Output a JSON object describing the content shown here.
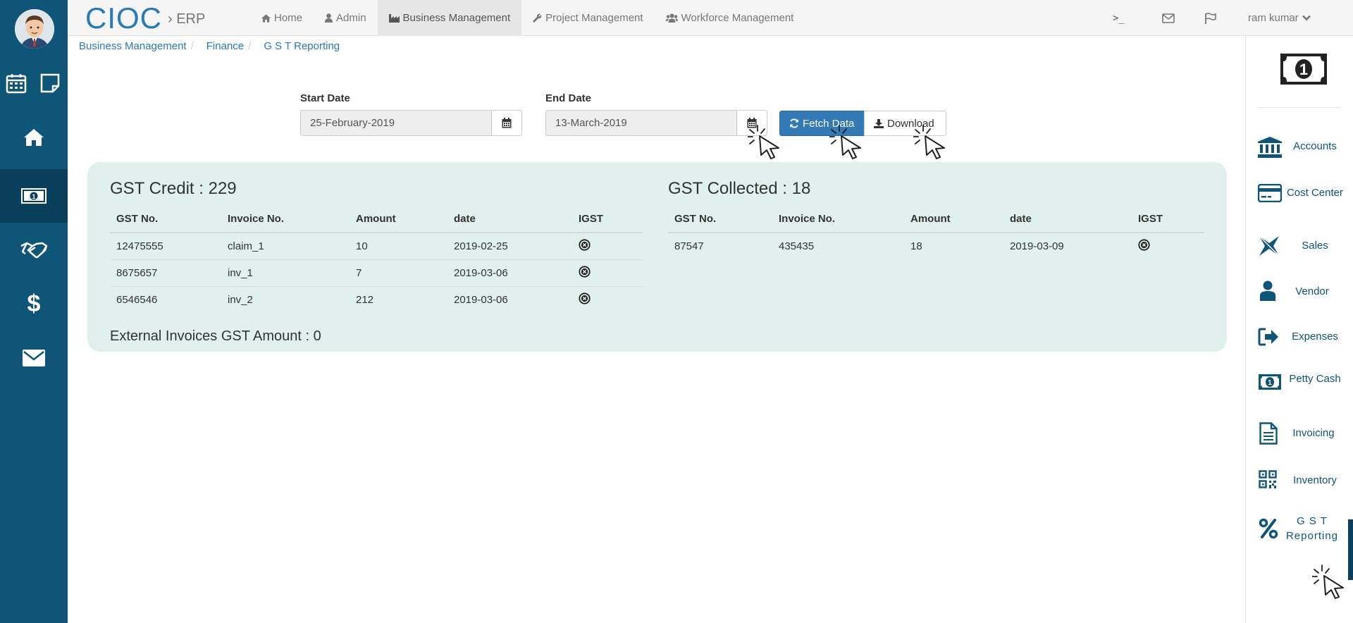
{
  "brand": {
    "name": "CIOC",
    "sub": "› ERP"
  },
  "nav": [
    {
      "label": "Home",
      "icon": "home-icon"
    },
    {
      "label": "Admin",
      "icon": "user-icon"
    },
    {
      "label": "Business Management",
      "icon": "industry-icon",
      "active": true
    },
    {
      "label": "Project Management",
      "icon": "wrench-icon"
    },
    {
      "label": "Workforce Management",
      "icon": "users-icon"
    }
  ],
  "top_right": {
    "terminal": ">_",
    "user": "ram kumar"
  },
  "breadcrumb": [
    "Business Management",
    "Finance",
    "G S T Reporting"
  ],
  "form": {
    "start_label": "Start Date",
    "start_value": "25-February-2019",
    "end_label": "End Date",
    "end_value": "13-March-2019",
    "fetch_label": "Fetch Data",
    "download_label": "Download"
  },
  "credit": {
    "title": "GST Credit : 229",
    "headers": [
      "GST No.",
      "Invoice No.",
      "Amount",
      "date",
      "IGST"
    ],
    "rows": [
      [
        "12475555",
        "claim_1",
        "10",
        "2019-02-25"
      ],
      [
        "8675657",
        "inv_1",
        "7",
        "2019-03-06"
      ],
      [
        "6546546",
        "inv_2",
        "212",
        "2019-03-06"
      ]
    ],
    "footer": "External Invoices GST Amount : 0"
  },
  "collected": {
    "title": "GST Collected : 18",
    "headers": [
      "GST No.",
      "Invoice No.",
      "Amount",
      "date",
      "IGST"
    ],
    "rows": [
      [
        "87547",
        "435435",
        "18",
        "2019-03-09"
      ]
    ]
  },
  "right_menu": [
    {
      "label": "Accounts",
      "icon": "bank-icon"
    },
    {
      "label": "Cost Center",
      "icon": "credit-card-icon"
    },
    {
      "label": "Sales",
      "icon": "sales-icon"
    },
    {
      "label": "Vendor",
      "icon": "user-icon"
    },
    {
      "label": "Expenses",
      "icon": "sign-out-icon"
    },
    {
      "label": "Petty Cash",
      "icon": "money-icon"
    },
    {
      "label": "Invoicing",
      "icon": "file-icon"
    },
    {
      "label": "Inventory",
      "icon": "qrcode-icon"
    },
    {
      "label": "G S T Reporting",
      "icon": "percent-icon",
      "active": true
    }
  ],
  "colors": {
    "sidebar": "#0f5578",
    "sidebar_active": "#0a3f5b",
    "link": "#2a7ab8",
    "panel": "#e0f0ed",
    "primary": "#337ab7"
  }
}
